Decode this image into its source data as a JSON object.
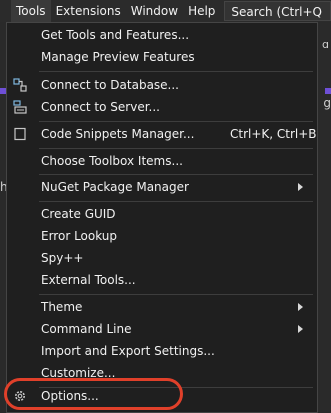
{
  "menubar": {
    "items": [
      "Tools",
      "Extensions",
      "Window",
      "Help"
    ],
    "search_label": "Search (Ctrl+Q"
  },
  "menu": {
    "items": [
      {
        "label": "Get Tools and Features..."
      },
      {
        "label": "Manage Preview Features"
      },
      {
        "label": "Connect to Database...",
        "icon": "database-connect-icon"
      },
      {
        "label": "Connect to Server...",
        "icon": "server-connect-icon"
      },
      {
        "label": "Code Snippets Manager...",
        "shortcut": "Ctrl+K, Ctrl+B",
        "icon": "snippet-icon"
      },
      {
        "label": "Choose Toolbox Items..."
      },
      {
        "label": "NuGet Package Manager",
        "submenu": true
      },
      {
        "label": "Create GUID"
      },
      {
        "label": "Error Lookup"
      },
      {
        "label": "Spy++"
      },
      {
        "label": "External Tools..."
      },
      {
        "label": "Theme",
        "submenu": true
      },
      {
        "label": "Command Line",
        "submenu": true
      },
      {
        "label": "Import and Export Settings..."
      },
      {
        "label": "Customize..."
      },
      {
        "label": "Options...",
        "icon": "gear-icon"
      }
    ]
  },
  "background": {
    "right_glyph": "ɑ",
    "right_g": "g",
    "left_h": "h"
  },
  "colors": {
    "highlight": "#e0402a",
    "accent": "#6e4fd6"
  }
}
